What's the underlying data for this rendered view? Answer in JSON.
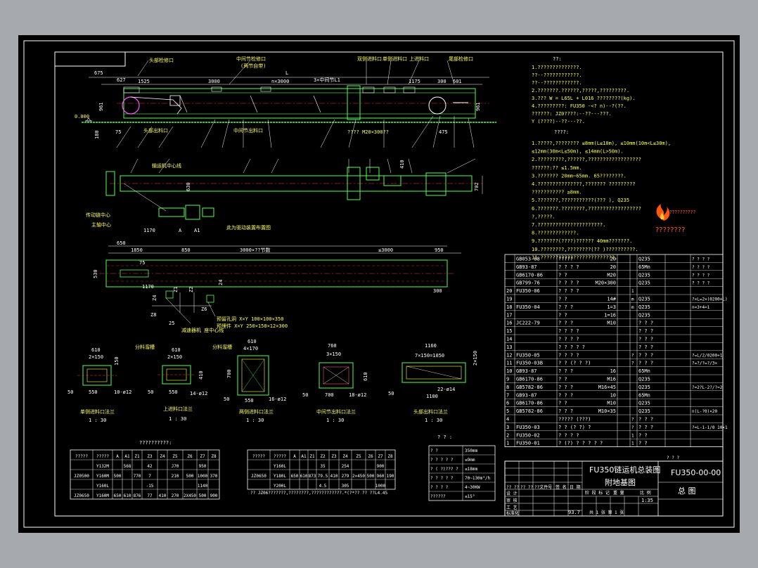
{
  "drawing": {
    "main_title": "FU350链运机总装图",
    "subtitle": "附地基图",
    "drawing_number": "FU350-00-00",
    "drawing_name": "总 图",
    "scale": "1:35",
    "weight": "93.7"
  },
  "labels": {
    "head_inspect": "头部检修口",
    "mid_inspect": "中间节检修口",
    "mid_inspect_sub": "(两节自带)",
    "double_feed": "双侧进料口",
    "single_feed": "单侧进料口",
    "top_feed": "上进料口",
    "tail_inspect": "尾部检修口",
    "head_discharge": "头部出料口",
    "mid_discharge": "中间节出料口",
    "level": "0.000",
    "dim_L": "L",
    "dim_675": "675",
    "dim_1525": "1525",
    "dim_3000": "3000",
    "dim_nx3000": "n×3000",
    "dim_mid_joint": "3×中间节L1",
    "dim_1175": "1175",
    "dim_300": "300",
    "dim_601": "601",
    "dim_961": "961",
    "dim_180": "180",
    "dim_75": "75",
    "dim_475": "475",
    "dim_627": "627",
    "bolts": "????  M20×300??",
    "conveyor_center": "输运机中心线",
    "drive_center": "传动链中心",
    "main_shaft_center": "主轴中心",
    "drive_note": "此为驱动装置布置图",
    "dim_1170": "1170",
    "dim_A": "A",
    "dim_A1": "A1",
    "dim_702": "702",
    "dim_410": "410",
    "dim_630": "630",
    "found_650": "650",
    "found_1850": "1850",
    "found_850": "850",
    "found_3000": "3000×??节数",
    "found_le3000": "≤3000",
    "found_950": "950",
    "found_530": "530",
    "found_75": "75",
    "found_1170": "1170",
    "found_300": "300",
    "found_24": "24",
    "found_Z1": "Z1",
    "found_Z2": "Z2",
    "found_Z4": "Z4",
    "found_Z5": "Z5",
    "found_Z6": "Z6",
    "found_Z8": "Z8",
    "found_25": "25",
    "reserve_hole1": "预留孔洞 X×Y 100×100×350",
    "reserve_hole2": "预埋件 X×Y 250×150×12×300",
    "reducer_center": "减速器机 座中心线",
    "sections": [
      {
        "name": "单侧进料口法兰",
        "scale": "1 : 30",
        "d1": "610",
        "d2": "2×150",
        "d3": "550",
        "d4": "10-ø12",
        "d5": "50",
        "d6": "150"
      },
      {
        "name": "上进料口法兰",
        "scale": "1 : 30",
        "d1": "610",
        "d2": "2×150",
        "d3": "550",
        "d4": "14-ø12",
        "d5": "50",
        "d6": "410"
      },
      {
        "name": "两侧进料口法兰",
        "scale": "1 : 30",
        "d1": "610",
        "d2": "4×170",
        "d3": "550",
        "d4": "16-ø12",
        "d5": "50",
        "d6": "700"
      },
      {
        "name": "中间节出料口法兰",
        "scale": "1 : 30",
        "d1": "760",
        "d2": "3×150",
        "d3": "700",
        "d4": "18-ø12",
        "d5": "50",
        "d6": "610"
      },
      {
        "name": "头部出料口法兰",
        "scale": "1 : 30",
        "d1": "1160",
        "d2": "7×150=1050",
        "d3": "1100",
        "d4": "22-ø14",
        "d5": "50",
        "d6": "2×150"
      }
    ],
    "split_material": "分料溜槽",
    "found_table_title": "??????????:",
    "tech_title": "??:",
    "tech_lines": [
      "1.??????????????.",
      "  ??--????????????.",
      "  ??--????????????.",
      "2.???????.??????,?????,?????????.",
      "3.???  W = L65L + L016  ????????(kg).",
      "4.?????????:    FU350 -<?  n)--?(??.",
      "  ??????:   JZ0????:--??---???.",
      "               Y (????)--??---??."
    ],
    "req_title": "????:",
    "req_lines": [
      "1.?????,????????    ≤8mm(L≤10m), ≤10mm(10m<L≤30m),",
      "  ≤12mm(30m<L≤50m), ≤14mm(L>50m).",
      "2.?????????,??????,??????????????????",
      "  ??????:??     ≤1.5mm.",
      "3.???????   20mm~65mm.    65????????.",
      "4.???????????????,???????      ?????????",
      "  ???????????      ≥8mm.",
      "5.???????,???????????(???     ),  Q235",
      "6.???????.????????,??????????????????",
      "  ?,?????.",
      "7.??????????????????????.",
      "8.?????????????.",
      "9.???????(????)??????     40mm???????.",
      "10.????????,????????(??      )??????????.",
      "11.?????????????????????????."
    ],
    "logo_text": "??????????",
    "logo_text2": "????????"
  },
  "bom": {
    "rows": [
      {
        "no": "",
        "code": "GB053-88",
        "name": "?????",
        "qty": "20",
        "u": "",
        "mat": "Q235",
        "note": "? ? ? ?"
      },
      {
        "no": "",
        "code": "GB93-87",
        "name": "? ? ? ?",
        "qty": "20",
        "u": "",
        "mat": "65Mn",
        "note": "? ? ? ?"
      },
      {
        "no": "",
        "code": "GB6170-86",
        "name": "? ?",
        "qty": "M20",
        "u": "",
        "mat": "Q235",
        "note": "? ? ? ?"
      },
      {
        "no": "",
        "code": "GB799-76",
        "name": "? ? ? ?",
        "qty": "M20×300",
        "u": "",
        "mat": "Q235",
        "note": "? ? ? ?"
      },
      {
        "no": "20",
        "code": "FU350-06",
        "name": "? ? ? ?",
        "qty": "",
        "u": "1",
        "mat": "",
        "note": ""
      },
      {
        "no": "19",
        "code": "",
        "name": "? ?",
        "qty": "14#",
        "u": "m",
        "mat": "Q235",
        "note": "?×L=2×(0200+L)"
      },
      {
        "no": "18",
        "code": "FU350-04",
        "name": "? ? ?",
        "qty": "1=3",
        "u": "m",
        "mat": "Q235",
        "note": "n=3+4=1"
      },
      {
        "no": "17",
        "code": "",
        "name": "? ?",
        "qty": "1=16",
        "u": "",
        "mat": "Q235",
        "note": ""
      },
      {
        "no": "16",
        "code": "JC222-79",
        "name": "? ? ?",
        "qty": "M10",
        "u": "",
        "mat": "? ? ?",
        "note": ""
      },
      {
        "no": "15",
        "code": "",
        "name": "? ? ? ?",
        "qty": "",
        "u": "",
        "mat": "? ? ?",
        "note": ""
      },
      {
        "no": "14",
        "code": "",
        "name": "? ? ? ?",
        "qty": "",
        "u": "",
        "mat": "? ? ?",
        "note": ""
      },
      {
        "no": "13",
        "code": "",
        "name": "? ? ? ? ?",
        "qty": "",
        "u": "",
        "mat": "? ? ?",
        "note": ""
      },
      {
        "no": "12",
        "code": "FU350-05",
        "name": "? ? ? ?",
        "qty": "",
        "u": "?",
        "mat": "? ? ?",
        "note": "?=L/2/0200+1"
      },
      {
        "no": "11",
        "code": "FU350-03B",
        "name": "? ? (? ? ?)",
        "qty": "",
        "u": "?",
        "mat": "? ? ?",
        "note": "?=?/?=?/3×"
      },
      {
        "no": "10",
        "code": "GB93-87",
        "name": "? ? ?",
        "qty": "16",
        "u": "",
        "mat": "65Mn",
        "note": ""
      },
      {
        "no": "9",
        "code": "GB6170-86",
        "name": "? ?",
        "qty": "M16",
        "u": "",
        "mat": "Q235",
        "note": ""
      },
      {
        "no": "8",
        "code": "GB5782-86",
        "name": "? ? ?",
        "qty": "M16×45",
        "u": "",
        "mat": "Q235",
        "note": "?=2?L-2?/?=2"
      },
      {
        "no": "7",
        "code": "GB93-87",
        "name": "? ? ?",
        "qty": "10",
        "u": "",
        "mat": "65Mn",
        "note": ""
      },
      {
        "no": "6",
        "code": "GB6170-86",
        "name": "? ?",
        "qty": "M10",
        "u": "",
        "mat": "Q235",
        "note": ""
      },
      {
        "no": "5",
        "code": "GB5782-86",
        "name": "? ? ?",
        "qty": "M10×35",
        "u": "",
        "mat": "Q235",
        "note": "n(L-?0)×20"
      },
      {
        "no": "4",
        "code": "",
        "name": "????? (???)",
        "qty": "",
        "u": "?",
        "mat": "? ? ?",
        "note": ""
      },
      {
        "no": "3",
        "code": "FU350-03",
        "name": "? ? (? ?) ?",
        "qty": "",
        "u": "?",
        "mat": "? ? ?",
        "note": "?=L-1-1/0 10×1"
      },
      {
        "no": "2",
        "code": "FU350-02",
        "name": "? ? ? ?",
        "qty": "",
        "u": "1",
        "mat": "? ?",
        "note": ""
      },
      {
        "no": "1",
        "code": "FU350-01",
        "name": "? (?) ? ? ? ? ?",
        "qty": "",
        "u": "1",
        "mat": "? ?",
        "note": ""
      }
    ]
  },
  "found_table_1": {
    "headers": [
      "?????",
      "?????",
      "A",
      "A1",
      "Z1",
      "Z3",
      "Z4",
      "Z5",
      "Z6",
      "Z7",
      "Z8"
    ],
    "rows": [
      [
        "",
        "Y132M",
        "",
        "568",
        "",
        "42",
        "",
        "J70",
        "",
        "950",
        ""
      ],
      [
        "JZ0500",
        "Y160M",
        "500",
        "",
        "770",
        "7",
        "",
        "210",
        "500",
        "1000",
        "370"
      ],
      [
        "",
        "Y160L",
        "",
        "",
        "",
        "-15",
        "",
        "",
        "",
        "1140",
        ""
      ],
      [
        "JZ0650",
        "Y160M",
        "650",
        "610",
        "876",
        "77",
        "410",
        "270",
        "2X450",
        "500",
        "900"
      ]
    ]
  },
  "found_table_2": {
    "headers": [
      "?????",
      "?????",
      "A",
      "A1",
      "Z1",
      "Z2",
      "Z3",
      "Z4",
      "Z5",
      "Z6",
      "Z7",
      "Z8"
    ],
    "rows": [
      [
        "",
        "Y160L",
        "",
        "",
        "",
        "35",
        "",
        "254",
        "",
        "",
        "900",
        ""
      ],
      [
        "JZ0650",
        "Y180L",
        "650",
        "610",
        "873",
        "79.5",
        "410",
        "279",
        "2×450",
        "500",
        "960",
        "190"
      ],
      [
        "",
        "Y200L",
        "",
        "",
        "",
        "4.5",
        "",
        "305",
        "",
        "",
        "1000",
        ""
      ]
    ],
    "note": "?? JZ06???????,????????,????????????.*(?*??   ??  ??L4.45"
  },
  "params": {
    "title": "? ? :",
    "rows": [
      [
        "? ?",
        "350mm"
      ],
      [
        "? ? ? ? ?",
        "≤9mm"
      ],
      [
        "? ( ?)??? ?",
        "≤18mm"
      ],
      [
        "? ? ? ? ?",
        "70~130m³/h"
      ],
      [
        "? ? ? ?",
        "4~30KW"
      ],
      [
        "??????",
        "≤15°"
      ]
    ]
  },
  "titleblock": {
    "rev_headers": [
      "?? ??",
      "?? ??",
      "??文件号",
      "签 名",
      "日 期"
    ],
    "sign_labels": [
      "设 计",
      "审 核",
      "工 艺",
      "标准化",
      "批 准"
    ],
    "stage_labels": [
      "阶 段 标 记",
      "重 量",
      "比 例"
    ],
    "sheet": "共 1 张 第 1 张",
    "corner": "? ? ?"
  },
  "colors": {
    "bg": "#000000",
    "frame": "#ffffff",
    "main": "#55ff55",
    "center": "#ff3333",
    "dim": "#ffffff",
    "label": "#ffff55",
    "accent": "#55ffff"
  }
}
